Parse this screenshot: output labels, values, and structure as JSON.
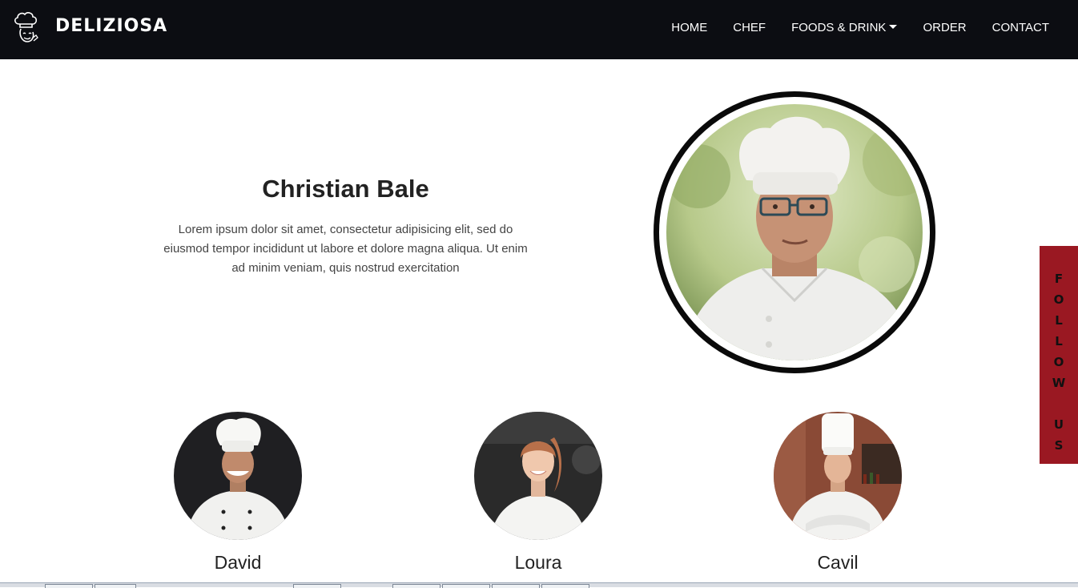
{
  "brand": {
    "name": "DELIZIOSA",
    "icon": "chef-hat-icon"
  },
  "nav": {
    "items": [
      {
        "label": "HOME"
      },
      {
        "label": "CHEF"
      },
      {
        "label": "FOODS & DRINK",
        "dropdown": true
      },
      {
        "label": "ORDER"
      },
      {
        "label": "CONTACT"
      }
    ]
  },
  "hero": {
    "name": "Christian Bale",
    "text": "Lorem ipsum dolor sit amet, consectetur adipisicing elit, sed do eiusmod tempor incididunt ut labore et dolore magna aliqua. Ut enim ad minim veniam, quis nostrud exercitation"
  },
  "follow": {
    "letters": [
      "F",
      "O",
      "L",
      "L",
      "O",
      "W",
      "",
      "U",
      "S"
    ]
  },
  "chefs": [
    {
      "name": "David"
    },
    {
      "name": "Loura"
    },
    {
      "name": "Cavil"
    }
  ],
  "colors": {
    "navbar": "#0c0d12",
    "follow_bg": "#9a1822",
    "photo_border": "#0a0a0a"
  }
}
